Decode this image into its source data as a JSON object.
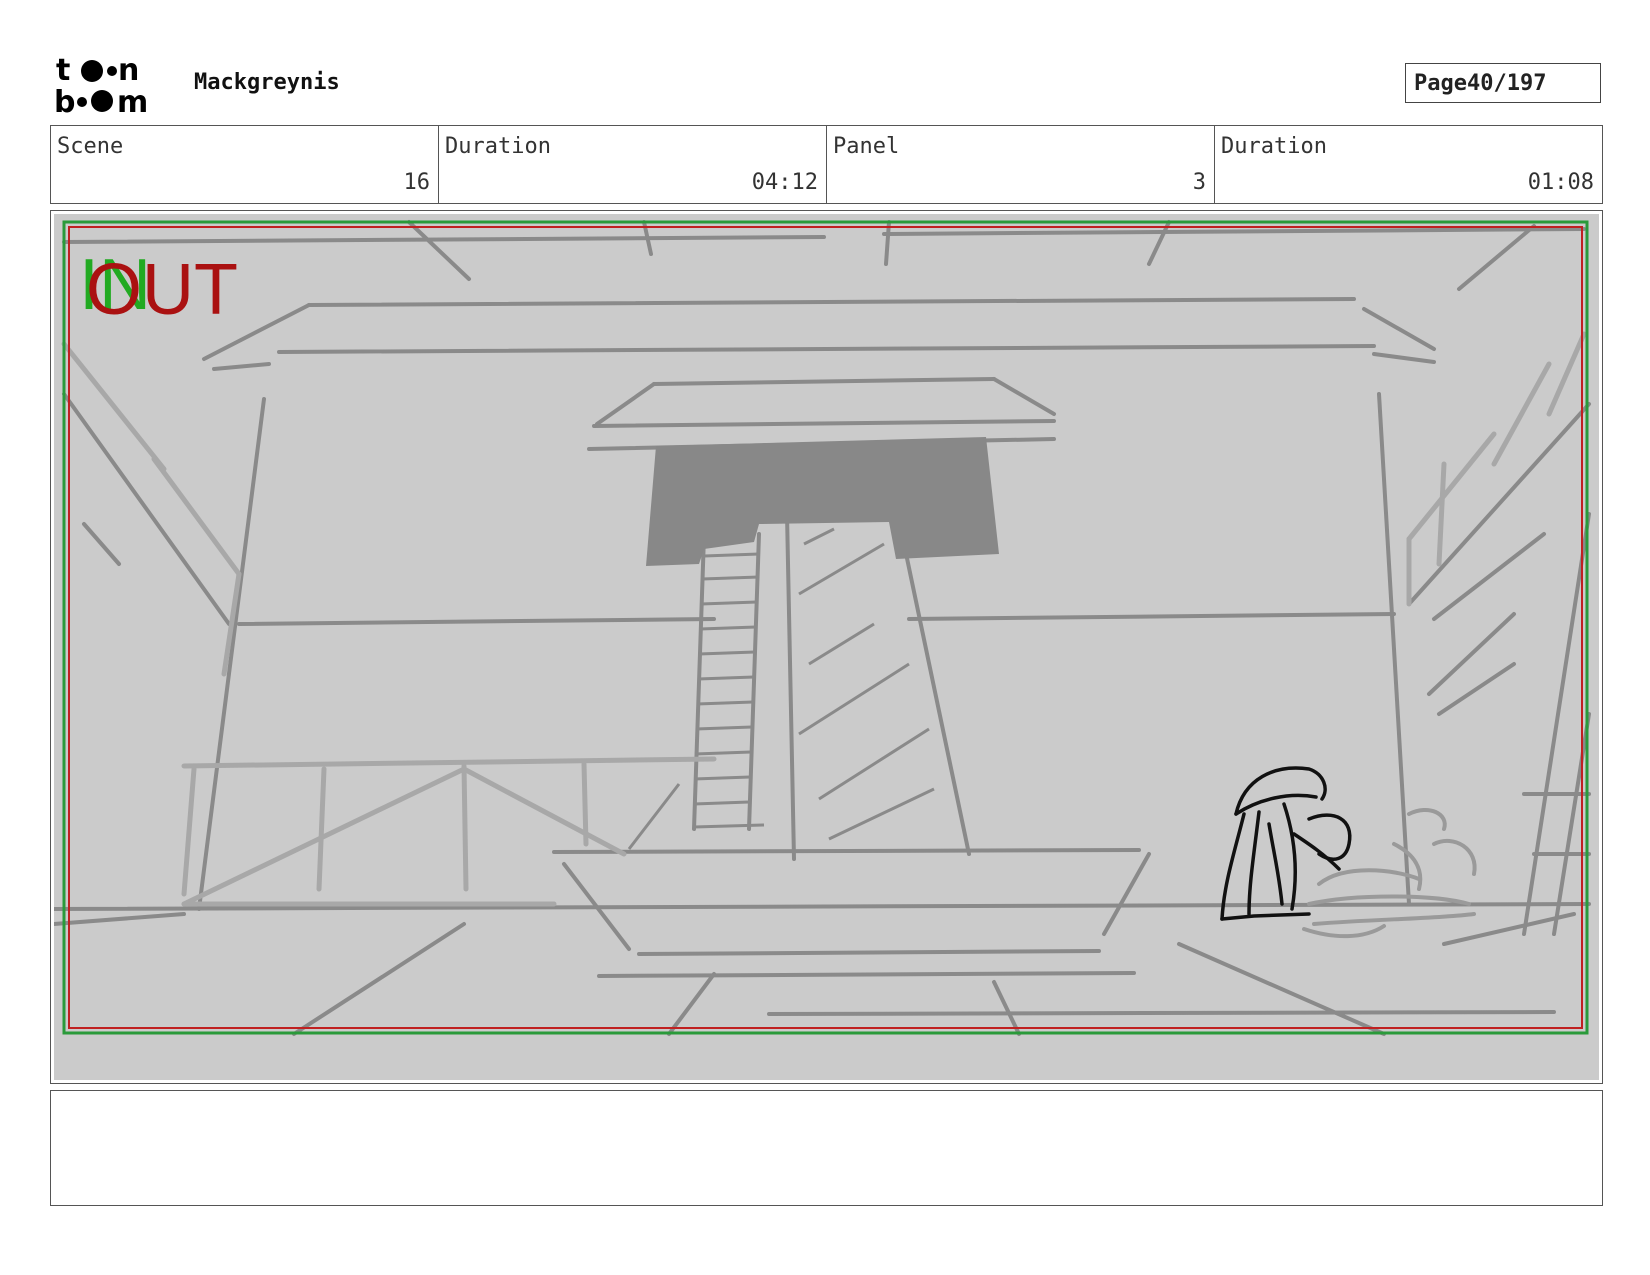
{
  "header": {
    "logo_text": "toon boom",
    "project_title": "Mackgreynis",
    "page_label": "Page",
    "page_value": "40/197"
  },
  "info": {
    "scene_label": "Scene",
    "scene_value": "16",
    "scene_duration_label": "Duration",
    "scene_duration_value": "04:12",
    "panel_label": "Panel",
    "panel_value": "3",
    "panel_duration_label": "Duration",
    "panel_duration_value": "01:08"
  },
  "panel": {
    "in_marker": "IN",
    "out_marker": "OUT",
    "colors": {
      "background": "#cbcbcb",
      "sketch_gray": "#8a8a8a",
      "light_sketch": "#a8a8a8",
      "dark_fill": "#888888",
      "character_ink": "#111111",
      "in_green": "#22aa22",
      "out_red": "#aa1111",
      "safe_frame_green": "#2a9a3a",
      "safe_frame_red": "#c02020"
    }
  },
  "notes": {
    "text": ""
  }
}
